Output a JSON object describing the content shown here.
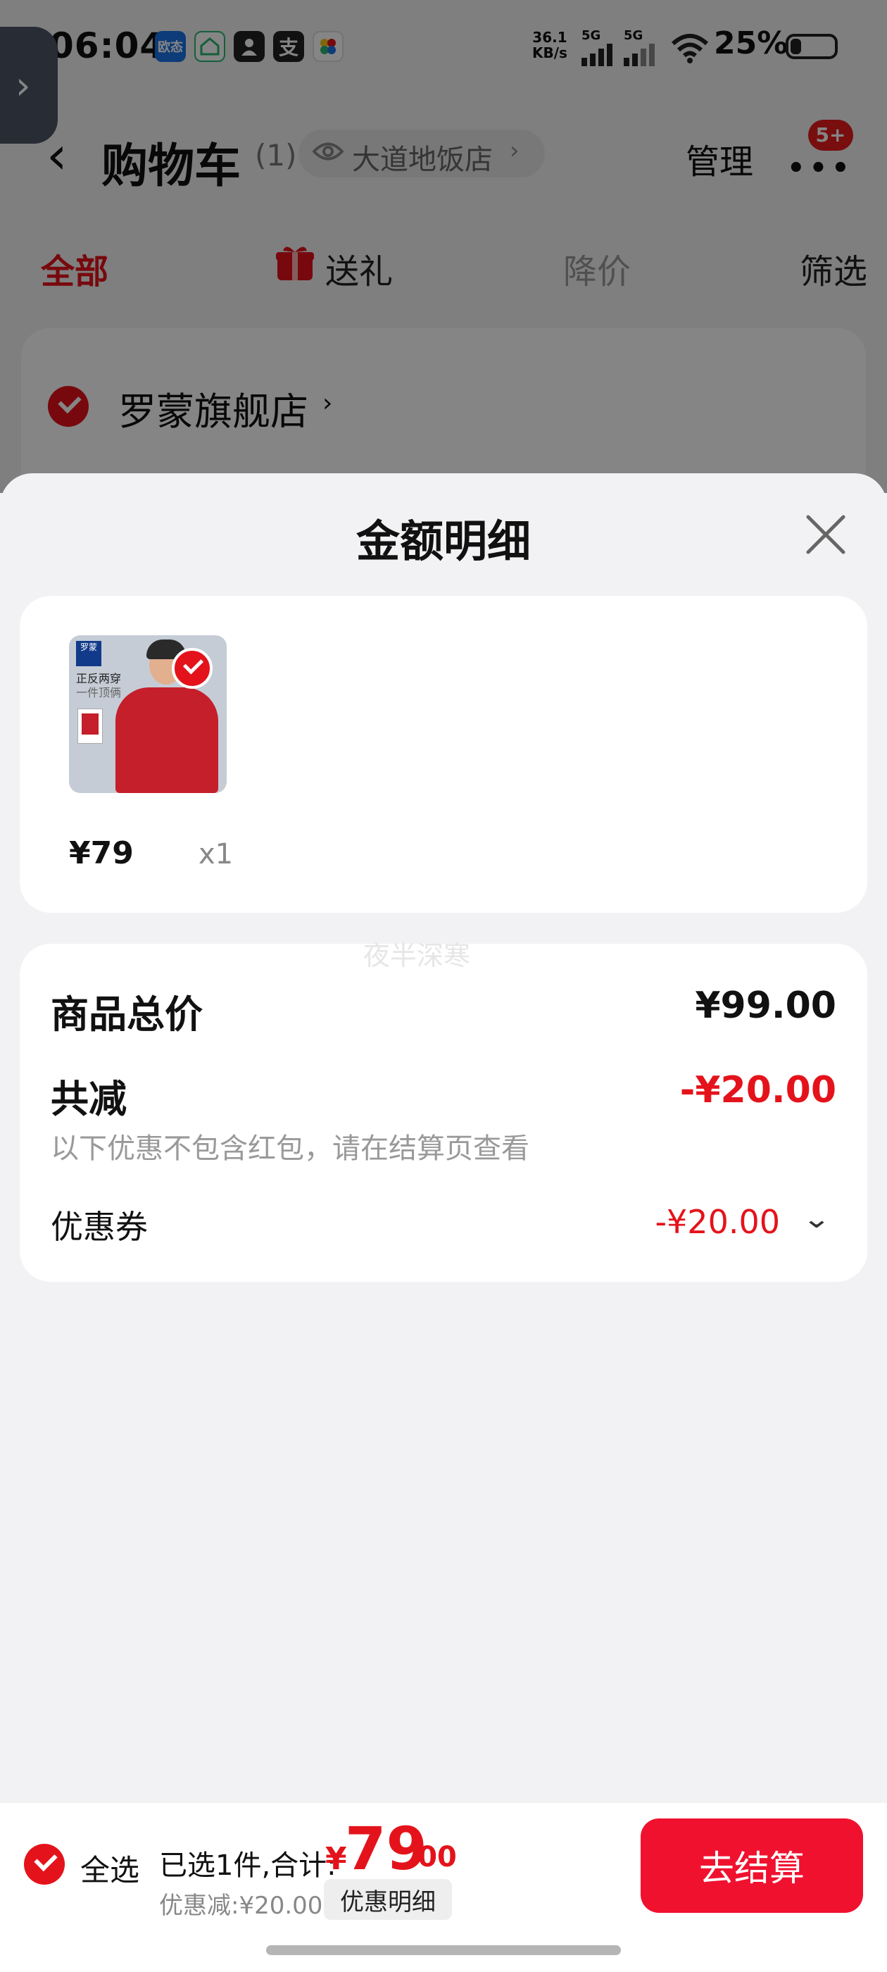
{
  "status_bar": {
    "time": "06:04",
    "app_icons": [
      {
        "name": "oupai-app-icon",
        "label": "欧态",
        "color": "#1a73e8"
      },
      {
        "name": "home-app-icon",
        "label": "",
        "color": "#2bb673"
      },
      {
        "name": "person-app-icon",
        "label": "",
        "color": "#222222"
      },
      {
        "name": "alipay-app-icon",
        "label": "支",
        "color": "#222222"
      },
      {
        "name": "flower-app-icon",
        "label": "",
        "color": "#f5c518"
      }
    ],
    "net_speed_value": "36.1",
    "net_speed_unit": "KB/s",
    "signal_1": "5G",
    "signal_2": "5G",
    "battery": "25%",
    "battery_level": 0.25
  },
  "header": {
    "title": "购物车",
    "count": "(1)",
    "store_pill": "大道地饭店",
    "manage": "管理",
    "badge": "5+"
  },
  "tabs": [
    {
      "label": "全部",
      "active": true
    },
    {
      "label": "送礼",
      "active": false
    },
    {
      "label": "降价",
      "active": false
    },
    {
      "label": "筛选",
      "active": false
    }
  ],
  "store": {
    "name": "罗蒙旗舰店"
  },
  "sheet": {
    "title": "金额明细",
    "product": {
      "brand_logo": "罗蒙",
      "image_caption_1": "正反两穿",
      "image_caption_2": "一件顶俩",
      "price": "¥79",
      "qty": "x1"
    },
    "watermark": "夜半深寒",
    "summary": {
      "total_label": "商品总价",
      "total_value": "¥99.00",
      "discount_label": "共减",
      "discount_value": "-¥20.00",
      "discount_note": "以下优惠不包含红包，请在结算页查看",
      "coupon_label": "优惠券",
      "coupon_value": "-¥20.00"
    }
  },
  "bottom_bar": {
    "select_all": "全选",
    "summary_text": "已选1件,合计:",
    "currency": "¥",
    "total_integer": "79",
    "total_decimal": ".00",
    "discount_text": "优惠减:¥20.00",
    "detail_button": "优惠明细",
    "checkout_button": "去结算"
  },
  "colors": {
    "accent": "#e4131b",
    "checkout": "#f0112f",
    "sheet_bg": "#f2f2f4"
  }
}
